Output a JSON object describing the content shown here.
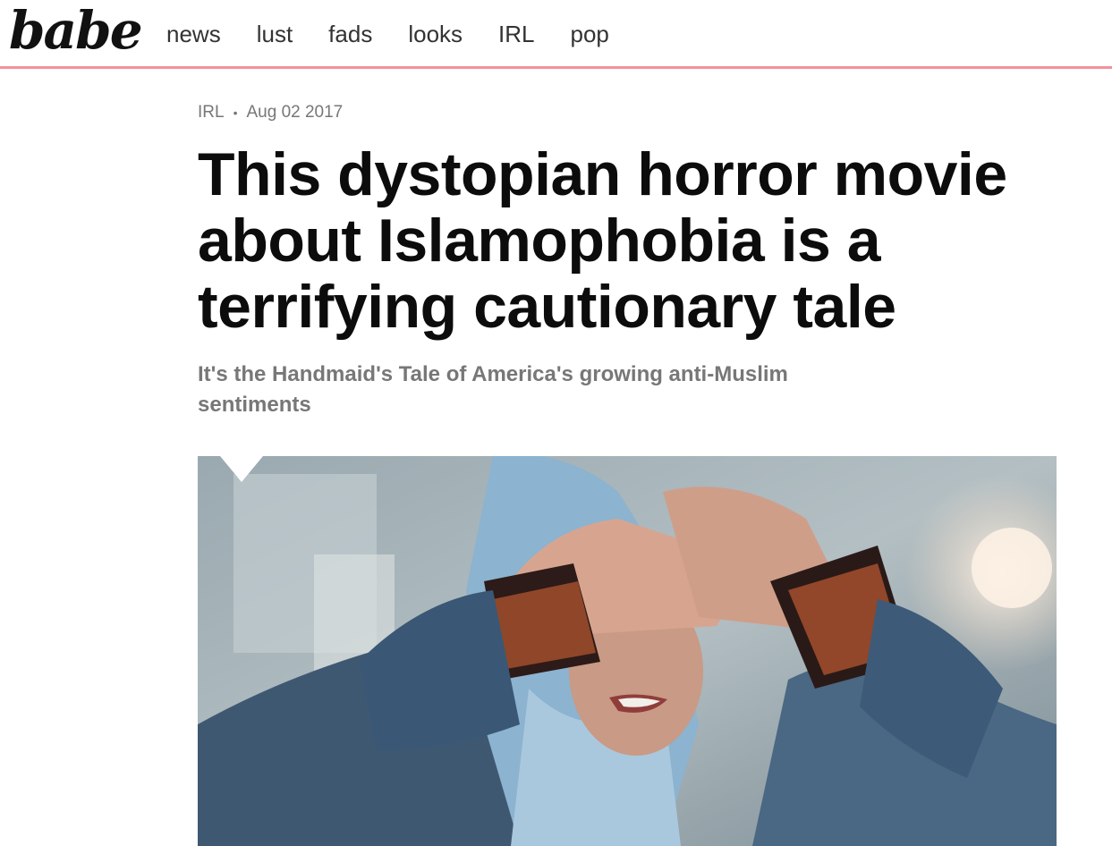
{
  "site": {
    "logo": "babe",
    "nav": [
      "news",
      "lust",
      "fads",
      "looks",
      "IRL",
      "pop"
    ],
    "accent_color": "#f4919b"
  },
  "article": {
    "category": "IRL",
    "separator": "•",
    "date": "Aug 02 2017",
    "headline": "This dystopian horror movie about Islamophobia is a terrifying cautionary tale",
    "subheadline": "It's the Handmaid's Tale of America's growing anti-Muslim sentiments"
  }
}
